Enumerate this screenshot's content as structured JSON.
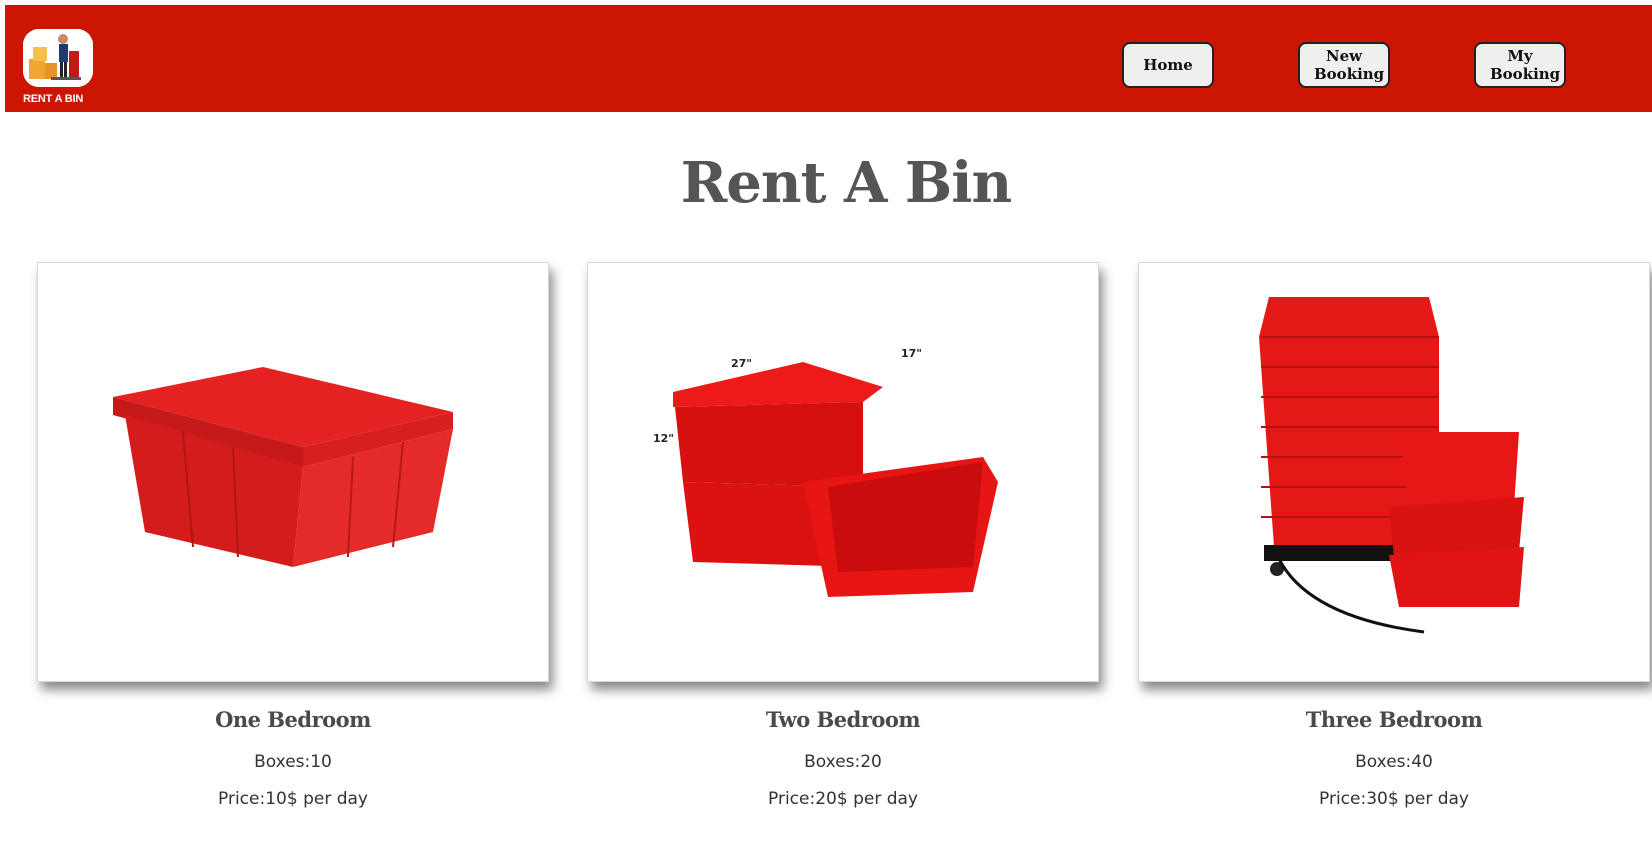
{
  "brand": {
    "logo_text": "RENT A BIN"
  },
  "nav": {
    "home_label": "Home",
    "new_booking_label": "New\nBooking",
    "my_booking_label": "My\nBooking"
  },
  "page": {
    "title": "Rent A Bin"
  },
  "cards": [
    {
      "title": "One Bedroom",
      "boxes": "Boxes:10",
      "price": "Price:10$ per day",
      "image": "single-red-bin"
    },
    {
      "title": "Two Bedroom",
      "boxes": "Boxes:20",
      "price": "Price:20$ per day",
      "image": "stacked-red-bins-with-dimensions",
      "dims": [
        "27\"",
        "17\"",
        "12\""
      ]
    },
    {
      "title": "Three Bedroom",
      "boxes": "Boxes:40",
      "price": "Price:30$ per day",
      "image": "tall-stack-red-bins-on-dolly"
    }
  ],
  "colors": {
    "navbar": "#cc1502",
    "bin_red": "#e10b0b",
    "title_gray": "#555555"
  }
}
